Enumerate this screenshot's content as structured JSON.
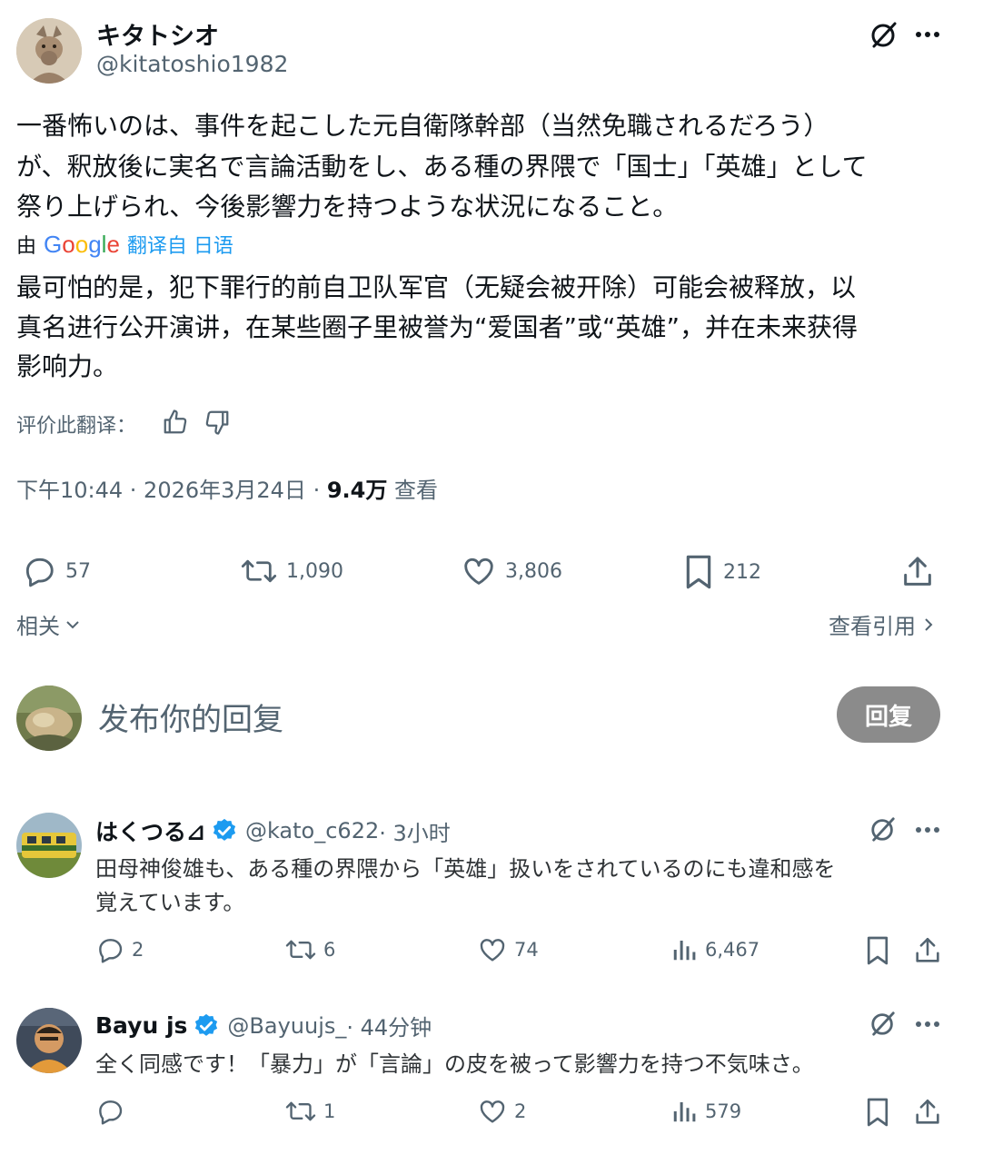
{
  "main_tweet": {
    "author_name": "キタトシオ",
    "author_handle": "@kitatoshio1982",
    "text_line1": "一番怖いのは、事件を起こした元自衛隊幹部（当然免職されるだろう）",
    "text_line2": "が、釈放後に実名で言論活動をし、ある種の界隈で「国士」「英雄」として",
    "text_line3": "祭り上げられ、今後影響力を持つような状況になること。",
    "translate_prefix": "由",
    "translate_google": "Google",
    "translate_suffix": "翻译自 日语",
    "translation_line1": "最可怕的是，犯下罪行的前自卫队军官（无疑会被开除）可能会被释放，以",
    "translation_line2": "真名进行公开演讲，在某些圈子里被誉为“爱国者”或“英雄”，并在未来获得",
    "translation_line3": "影响力。",
    "rate_label": "评价此翻译：",
    "time": "下午10:44 · 2026年3月24日 · ",
    "views_count": "9.4万",
    "views_label": " 查看",
    "stats": {
      "replies": "57",
      "retweets": "1,090",
      "likes": "3,806",
      "bookmarks": "212"
    },
    "related_label": "相关",
    "view_quotes_label": "查看引用"
  },
  "reply_box": {
    "placeholder": "发布你的回复",
    "button_label": "回复"
  },
  "replies": [
    {
      "name": "はくつる⊿",
      "handle": "@kato_c622",
      "time": " · 3小时",
      "text_line1": "田母神俊雄も、ある種の界隈から「英雄」扱いをされているのにも違和感を",
      "text_line2": "覚えています。",
      "replies": "2",
      "retweets": "6",
      "likes": "74",
      "views": "6,467"
    },
    {
      "name": "Bayu js",
      "handle": "@Bayuujs_",
      "time": " · 44分钟",
      "text_line1": "全く同感です！「暴力」が「言論」の皮を被って影響力を持つ不気味さ。",
      "replies": "",
      "retweets": "1",
      "likes": "2",
      "views": "579"
    }
  ],
  "colors": {
    "text": "#0f1419",
    "muted": "#536471",
    "verified": "#1d9bf0",
    "translate_link": "#1d9bf0",
    "reply_button_bg": "#8b8b8b"
  }
}
